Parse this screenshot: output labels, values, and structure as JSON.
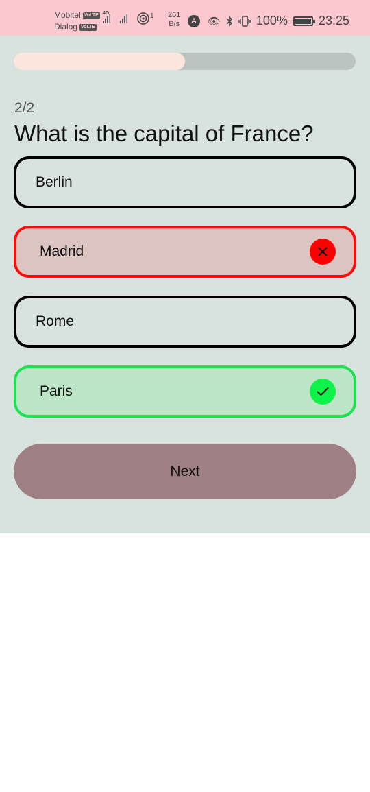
{
  "status_bar": {
    "carrier1": "Mobitel",
    "carrier2": "Dialog",
    "volte": "VoLTE",
    "network": "4G",
    "hotspot_count": "1",
    "speed_value": "261",
    "speed_unit": "B/s",
    "a_badge": "A",
    "battery": "100%",
    "time": "23:25"
  },
  "quiz": {
    "progress": 0.5,
    "counter": "2/2",
    "question": "What is the capital of France?",
    "options": [
      {
        "label": "Berlin",
        "state": "neutral"
      },
      {
        "label": "Madrid",
        "state": "wrong"
      },
      {
        "label": "Rome",
        "state": "neutral"
      },
      {
        "label": "Paris",
        "state": "correct"
      }
    ],
    "next_label": "Next"
  },
  "colors": {
    "status_bar_bg": "#fbc8cf",
    "app_bg": "#d8e2de",
    "wrong": "#ff0a0a",
    "correct": "#1de24f",
    "next_button": "#9e8084"
  }
}
